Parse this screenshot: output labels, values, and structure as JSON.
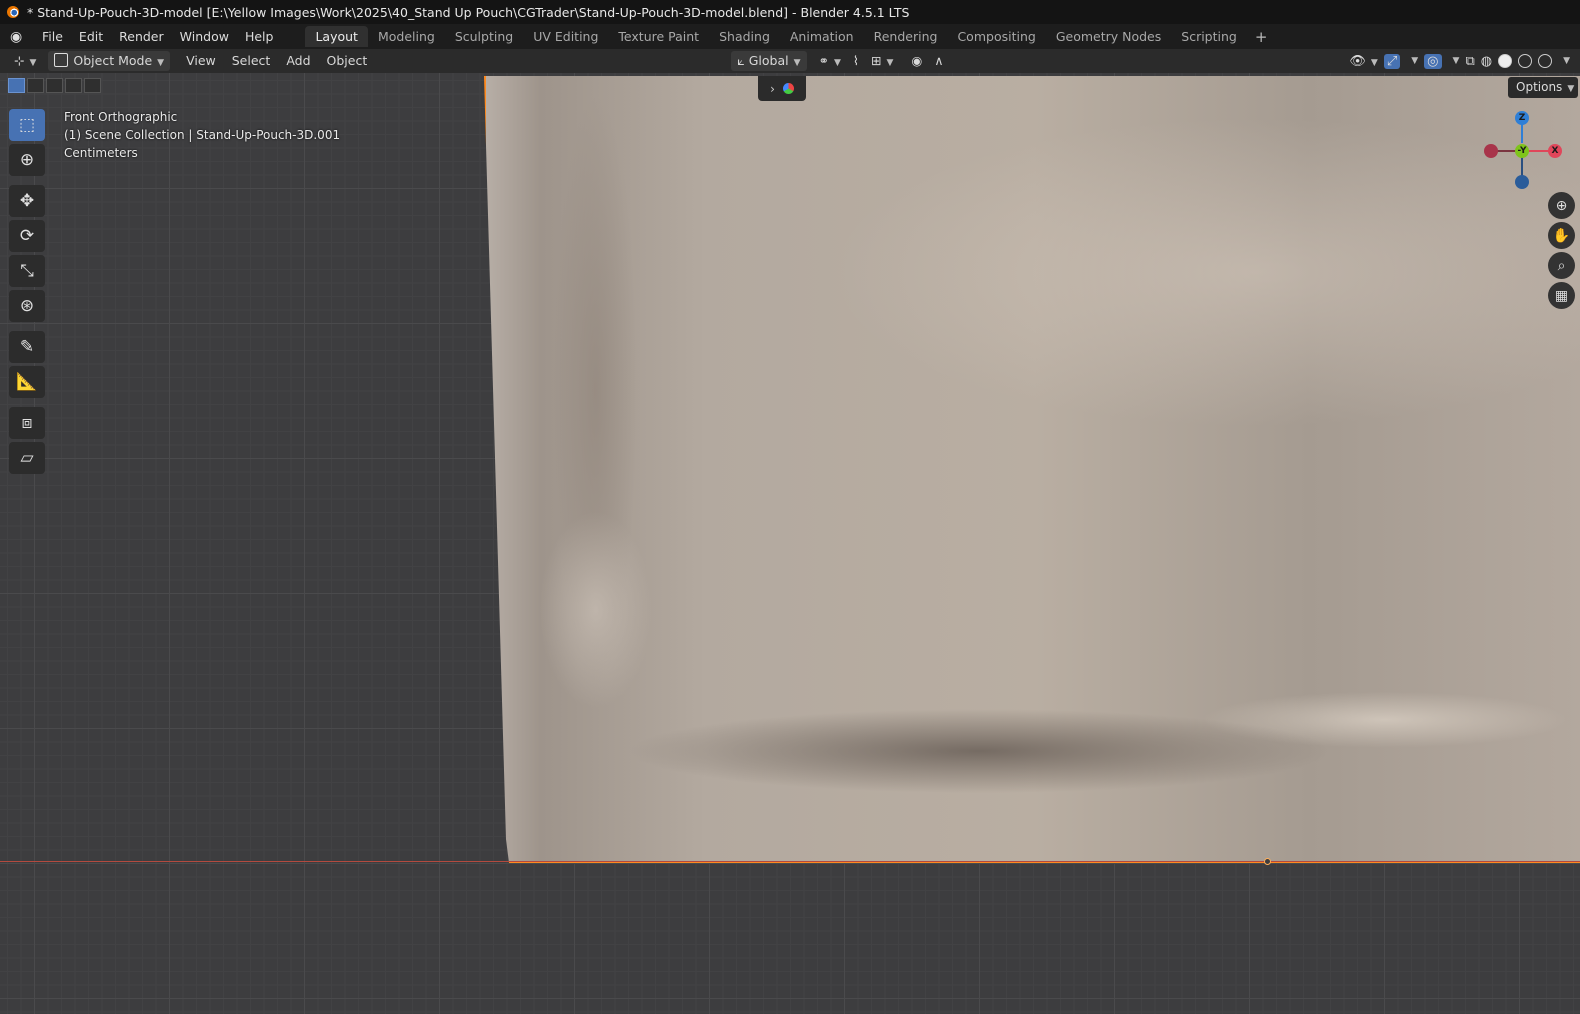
{
  "window": {
    "title": "* Stand-Up-Pouch-3D-model [E:\\Yellow Images\\Work\\2025\\40_Stand Up Pouch\\CGTrader\\Stand-Up-Pouch-3D-model.blend] - Blender 4.5.1 LTS"
  },
  "menu": [
    "File",
    "Edit",
    "Render",
    "Window",
    "Help"
  ],
  "workspaces": [
    "Layout",
    "Modeling",
    "Sculpting",
    "UV Editing",
    "Texture Paint",
    "Shading",
    "Animation",
    "Rendering",
    "Compositing",
    "Geometry Nodes",
    "Scripting"
  ],
  "active_workspace": "Layout",
  "header3d": {
    "mode": "Object Mode",
    "view": "View",
    "select": "Select",
    "add": "Add",
    "object": "Object",
    "transform_orientation": "Global",
    "options": "Options"
  },
  "overlay": {
    "view_name": "Front Orthographic",
    "collection": "(1) Scene Collection | Stand-Up-Pouch-3D.001",
    "units": "Centimeters"
  },
  "gizmo": {
    "z": "Z",
    "y": "-Y",
    "x": "X"
  },
  "colors": {
    "selection_outline": "#ff8a1f",
    "active_tool": "#4772b3",
    "x_axis": "#e0465a",
    "y_axis": "#7fc41c",
    "z_axis": "#2f7fd6"
  }
}
